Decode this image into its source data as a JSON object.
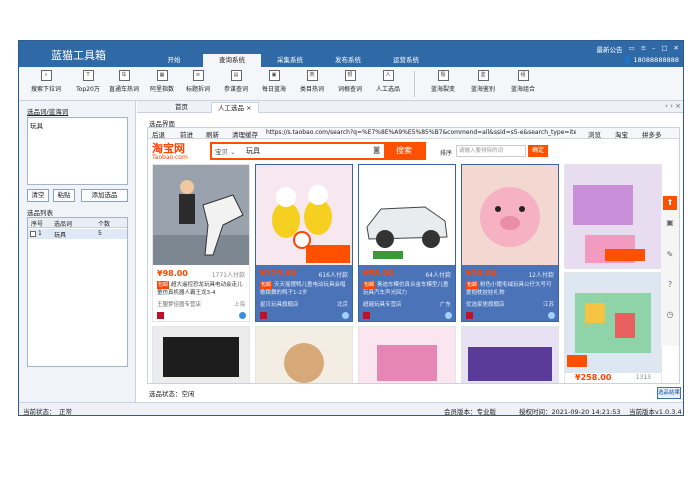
{
  "app": {
    "title": "蓝猫工具箱"
  },
  "menu_tabs": [
    {
      "label": "开始"
    },
    {
      "label": "查询系统"
    },
    {
      "label": "采集系统"
    },
    {
      "label": "发布系统"
    },
    {
      "label": "运营系统"
    }
  ],
  "titlebar_right": {
    "notice": "最新公告",
    "user": "18088888888"
  },
  "toolbar": [
    {
      "label": "搜索下拉词",
      "icon": "search-dropdown-icon"
    },
    {
      "label": "Top20万",
      "icon": "top-icon"
    },
    {
      "label": "直通车热词",
      "icon": "car-icon"
    },
    {
      "label": "阿里指数",
      "icon": "index-icon"
    },
    {
      "label": "标题拆词",
      "icon": "split-icon"
    },
    {
      "label": "参谋查词",
      "icon": "advisor-icon"
    },
    {
      "label": "每日蓝海",
      "icon": "daily-icon"
    },
    {
      "label": "类目热词",
      "icon": "category-icon"
    },
    {
      "label": "词根查词",
      "icon": "root-icon"
    },
    {
      "label": "人工选品",
      "icon": "person-icon"
    },
    {
      "label": "蓝海裂变",
      "icon": "fission-icon"
    },
    {
      "label": "蓝海鉴别",
      "icon": "identify-icon"
    },
    {
      "label": "蓝海组合",
      "icon": "combine-icon"
    }
  ],
  "left": {
    "keywords_label": "选品词/蓝海词",
    "keywords_value": "玩具",
    "clear_btn": "清空",
    "paste_btn": "粘贴",
    "add_btn": "添加选品",
    "list_label": "选品列表",
    "columns": [
      "序号",
      "选品词",
      "个数"
    ],
    "rows": [
      {
        "index": "1",
        "word": "玩具",
        "count": "5"
      }
    ]
  },
  "doc_tabs": [
    {
      "label": "首页"
    },
    {
      "label": "人工选品"
    }
  ],
  "main": {
    "section_label": "选品界面"
  },
  "browser": {
    "nav": [
      "后退",
      "前进",
      "刷新",
      "清理缓存"
    ],
    "url": "https://s.taobao.com/search?q=%E7%8E%A9%E5%85%B7&commend=all&ssid=s5-e&search_type=iten",
    "nav_right": [
      "浏览",
      "淘宝",
      "拼多多"
    ],
    "logo": "淘宝网",
    "logo_sub": "Taobao.com",
    "search_cat": "宝贝",
    "search_text": "玩具",
    "search_btn": "搜索",
    "sort_label": "排序",
    "sort_placeholder": "请输入要排除的词",
    "sort_btn": "确定"
  },
  "products": [
    {
      "price": "¥98.00",
      "sales": "1771人付款",
      "desc": "超大遥控恐龙玩具电动会走儿童仿真机器人霸王龙3-4",
      "shop": "王盟梦佳圆专营店",
      "loc": "上海",
      "tag": "包邮"
    },
    {
      "price": "¥129.00",
      "sales": "616人付款",
      "desc": "天天摇摆鸭儿童电动玩具会唱歌跳舞的鸭子1-2岁",
      "shop": "星贝玩具旗舰店",
      "loc": "北京",
      "tag": "包邮"
    },
    {
      "price": "¥58.00",
      "sales": "64人付款",
      "desc": "奥迪车模仿真合金车模型儿童玩具汽车声光回力",
      "shop": "超越玩具专营店",
      "loc": "广东",
      "tag": "包邮"
    },
    {
      "price": "¥38.00",
      "sales": "12人付款",
      "desc": "粉色小猪毛绒玩具公仔大号可爱抱枕娃娃礼物",
      "shop": "优选家居旗舰店",
      "loc": "江苏",
      "tag": "包邮"
    },
    {
      "price": "¥258.00",
      "sales": "1313",
      "desc": "",
      "shop": "",
      "loc": "",
      "tag": ""
    }
  ],
  "bottom_left_status": "选品状态：空闲",
  "copy_btn": "选品结果",
  "statusbar": {
    "current": "当前状态：",
    "state": "正常",
    "member": "会员版本：专业版",
    "auth_time": "授权时间：2021-09-20 14:21:53",
    "version": "当前版本v1.0.3.4"
  },
  "colors": {
    "titlebar": "#2f6aa6",
    "accent": "#ff5000",
    "selected_card": "#4a73b8"
  }
}
